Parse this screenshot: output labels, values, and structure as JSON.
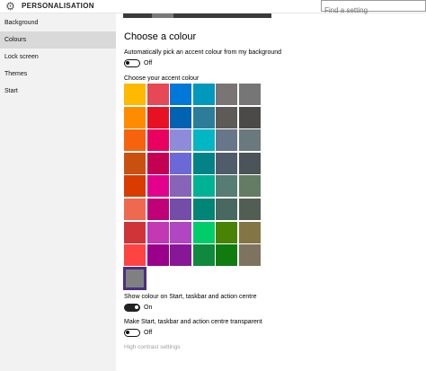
{
  "app": {
    "title": "PERSONALISATION",
    "search_placeholder": "Find a setting"
  },
  "sidebar": {
    "items": [
      {
        "label": "Background",
        "active": false
      },
      {
        "label": "Colours",
        "active": true
      },
      {
        "label": "Lock screen",
        "active": false
      },
      {
        "label": "Themes",
        "active": false
      },
      {
        "label": "Start",
        "active": false
      }
    ]
  },
  "main": {
    "heading": "Choose a colour",
    "auto_pick_label": "Automatically pick an accent colour from my background",
    "auto_pick_state": "Off",
    "accent_label": "Choose your accent colour",
    "show_colour_label": "Show colour on Start, taskbar and action centre",
    "show_colour_state": "On",
    "transparent_label": "Make Start, taskbar and action centre transparent",
    "transparent_state": "Off",
    "high_contrast_link": "High contrast settings"
  },
  "swatches": [
    [
      "#FFB900",
      "#E74856",
      "#0078D7",
      "#0099BC",
      "#7A7574",
      "#767676"
    ],
    [
      "#FF8C00",
      "#E81123",
      "#0063B1",
      "#2D7D9A",
      "#5D5A58",
      "#4C4A48"
    ],
    [
      "#F7630C",
      "#EA005E",
      "#8E8CD8",
      "#00B7C3",
      "#68768A",
      "#69797E"
    ],
    [
      "#CA5010",
      "#C30052",
      "#6B69D6",
      "#038387",
      "#515C6B",
      "#4A5459"
    ],
    [
      "#DA3B01",
      "#E3008C",
      "#8764B8",
      "#00B294",
      "#567C73",
      "#647C64"
    ],
    [
      "#EF6950",
      "#BF0077",
      "#744DA9",
      "#018574",
      "#486860",
      "#525E54"
    ],
    [
      "#D13438",
      "#C239B3",
      "#B146C2",
      "#00CC6A",
      "#498205",
      "#847545"
    ],
    [
      "#FF4343",
      "#9A0089",
      "#881798",
      "#10893E",
      "#107C10",
      "#7E735F"
    ],
    [
      "#808080"
    ]
  ],
  "selected_swatch": "#808080"
}
